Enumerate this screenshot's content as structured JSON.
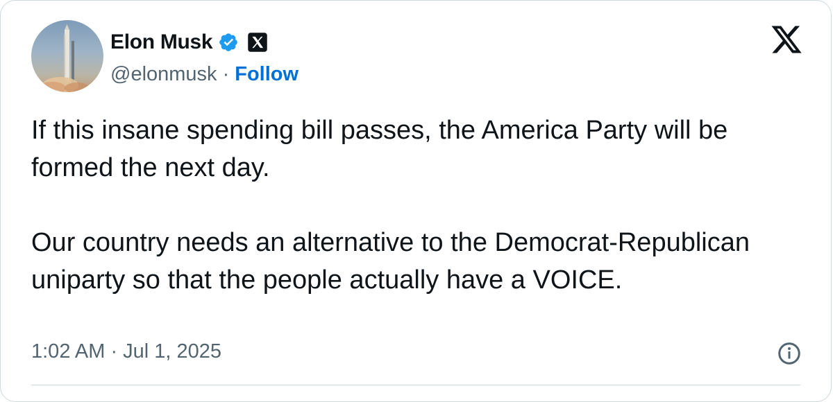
{
  "author": {
    "name": "Elon Musk",
    "handle": "@elonmusk",
    "separator": "·",
    "follow_label": "Follow"
  },
  "tweet": {
    "paragraphs": [
      "If this insane spending bill passes, the America Party will be formed the next day.",
      "Our country needs an alternative to the Democrat-Republican uniparty so that the people actually have a VOICE."
    ],
    "timestamp": "1:02 AM · Jul 1, 2025"
  },
  "icons": {
    "verified": "verified-badge-icon",
    "affiliation": "x-affiliation-icon",
    "platform": "x-logo-icon",
    "info": "info-icon"
  },
  "colors": {
    "text_primary": "#0f1419",
    "text_secondary": "#536471",
    "follow_link": "#006fd6",
    "verified_badge": "#1d9bf0",
    "border": "#cfd9de"
  }
}
